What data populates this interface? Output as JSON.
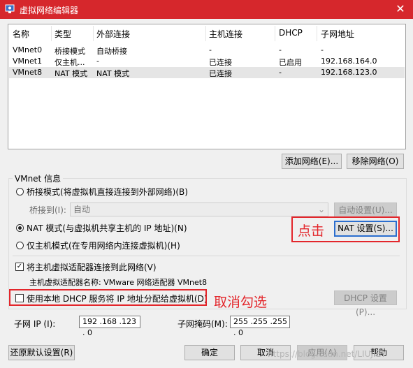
{
  "window": {
    "title": "虚拟网络编辑器",
    "close": "✕",
    "accent": "#d6272c"
  },
  "table": {
    "headers": [
      "名称",
      "类型",
      "外部连接",
      "主机连接",
      "DHCP",
      "子网地址"
    ],
    "rows": [
      {
        "name": "VMnet0",
        "type": "桥接模式",
        "external": "自动桥接",
        "host": "-",
        "dhcp": "-",
        "subnet": "-"
      },
      {
        "name": "VMnet1",
        "type": "仅主机...",
        "external": "-",
        "host": "已连接",
        "dhcp": "已启用",
        "subnet": "192.168.164.0"
      },
      {
        "name": "VMnet8",
        "type": "NAT 模式",
        "external": "NAT 模式",
        "host": "已连接",
        "dhcp": "-",
        "subnet": "192.168.123.0"
      }
    ]
  },
  "buttons": {
    "add_network": "添加网络(E)...",
    "remove_network": "移除网络(O)",
    "auto_settings": "自动设置(U)...",
    "nat_settings": "NAT 设置(S)...",
    "dhcp_settings": "DHCP 设置(P)...",
    "restore_defaults": "还原默认设置(R)",
    "ok": "确定",
    "cancel": "取消",
    "apply": "应用(A)",
    "help": "帮助"
  },
  "vmnet_info": {
    "group_title": "VMnet 信息",
    "bridged_radio": "桥接模式(将虚拟机直接连接到外部网络)(B)",
    "bridged_to_label": "桥接到(I):",
    "bridged_to_value": "自动",
    "nat_radio": "NAT 模式(与虚拟机共享主机的 IP 地址)(N)",
    "hostonly_radio": "仅主机模式(在专用网络内连接虚拟机)(H)",
    "connect_adapter_check": "将主机虚拟适配器连接到此网络(V)",
    "connect_adapter_checked": true,
    "adapter_name_label": "主机虚拟适配器名称: VMware 网络适配器 VMnet8",
    "dhcp_check": "使用本地 DHCP 服务将 IP 地址分配给虚拟机(D)",
    "dhcp_checked": false,
    "subnet_ip_label": "子网 IP (I):",
    "subnet_ip_value": "192 .168 .123 . 0",
    "subnet_mask_label": "子网掩码(M):",
    "subnet_mask_value": "255 .255 .255 . 0"
  },
  "annotations": {
    "click": "点击",
    "uncheck": "取消勾选",
    "color": "#e3262b"
  },
  "watermark": "https://blog.csdn.net/LIUJIEY"
}
